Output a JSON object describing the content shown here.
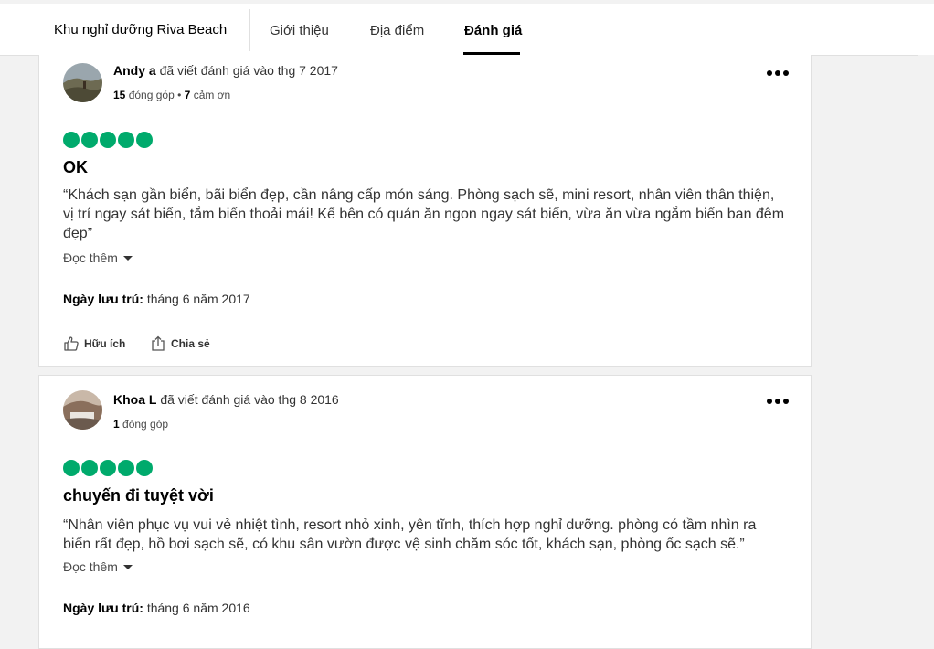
{
  "nav": {
    "brand": "Khu nghỉ dưỡng Riva Beach",
    "tabs": [
      {
        "label": "Giới thiệu",
        "active": false
      },
      {
        "label": "Địa điểm",
        "active": false
      },
      {
        "label": "Đánh giá",
        "active": true
      }
    ]
  },
  "colors": {
    "bubble": "#00aa6c",
    "accent": "#000000"
  },
  "reviews": [
    {
      "name": "Andy a",
      "wrote": "đã viết đánh giá vào thg 7 2017",
      "contrib_count": "15",
      "contrib_label": "đóng góp",
      "sep": "•",
      "thanks_count": "7",
      "thanks_label": "cảm ơn",
      "rating": 5,
      "title": "OK",
      "body": "“Khách sạn gần biển, bãi biển đẹp, cần nâng cấp món sáng. Phòng sạch sẽ, mini resort, nhân viên thân thiện, vị trí ngay sát biển, tắm biển thoải mái! Kế bên có quán ăn ngon ngay sát biển, vừa ăn vừa ngắm biển ban đêm đẹp”",
      "read_more": "Đọc thêm",
      "stay_label": "Ngày lưu trú:",
      "stay_value": "tháng 6 năm 2017",
      "helpful_label": "Hữu ích",
      "share_label": "Chia sẻ"
    },
    {
      "name": "Khoa L",
      "wrote": "đã viết đánh giá vào thg 8 2016",
      "contrib_count": "1",
      "contrib_label": "đóng góp",
      "rating": 5,
      "title": "chuyến đi tuyệt vời",
      "body": "“Nhân viên phục vụ vui vẻ nhiệt tình, resort nhỏ xinh, yên tĩnh, thích hợp nghỉ dưỡng. phòng có tầm nhìn ra biển rất đẹp, hồ bơi sạch sẽ, có khu sân vườn được vệ sinh chăm sóc tốt, khách sạn, phòng ốc sạch sẽ.”",
      "read_more": "Đọc thêm",
      "stay_label": "Ngày lưu trú:",
      "stay_value": "tháng 6 năm 2016"
    }
  ]
}
